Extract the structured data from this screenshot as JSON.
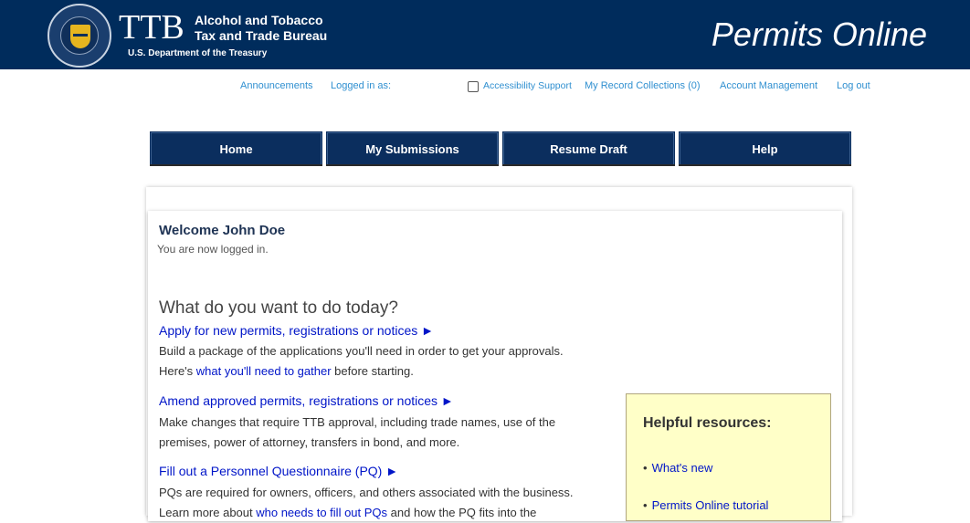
{
  "header": {
    "agency_short": "TTB",
    "agency_line1": "Alcohol and Tobacco",
    "agency_line2": "Tax and Trade Bureau",
    "department": "U.S. Department of the Treasury",
    "app_title": "Permits Online",
    "seal_text": "ALCOHOL AND TOBACCO TAX AND TRADE BUREAU"
  },
  "utility": {
    "announcements": "Announcements",
    "logged_in_as": "Logged in as:",
    "accessibility": "Accessibility Support",
    "accessibility_checked": false,
    "record_collections": "My Record Collections (0)",
    "account_management": "Account Management",
    "logout": "Log out"
  },
  "nav": {
    "home": "Home",
    "submissions": "My Submissions",
    "resume_draft": "Resume Draft",
    "help": "Help"
  },
  "welcome": {
    "greeting": "Welcome",
    "user_name": "John Doe",
    "status": "You are now logged in."
  },
  "main": {
    "question": "What do you want to do today?",
    "apply": {
      "title": "Apply for new permits, registrations or notices ►",
      "line1": "Build a package of the applications you'll need in order to get your approvals.",
      "line2_prefix": "Here's ",
      "line2_link": "what you'll need to gather",
      "line2_suffix": " before starting."
    },
    "amend": {
      "title": "Amend approved permits, registrations or notices ►",
      "line1": "Make changes that require TTB approval, including trade names, use of the",
      "line2": "premises, power of attorney, transfers in bond, and more."
    },
    "pq": {
      "title": "Fill out a Personnel Questionnaire (PQ) ►",
      "line1": "PQs are required for owners, officers, and others associated with the business.",
      "line2_prefix": "Learn more about ",
      "line2_link": "who needs to fill out PQs",
      "line2_suffix": " and how the PQ fits into the"
    }
  },
  "resources": {
    "title": "Helpful resources:",
    "items": [
      "What's new",
      "Permits Online tutorial"
    ]
  },
  "colors": {
    "header_bg": "#002c5c",
    "nav_bg": "#0b2e5e",
    "link": "#0015c8",
    "utility_link": "#2f8fd0",
    "resources_bg": "#ffffc8"
  }
}
